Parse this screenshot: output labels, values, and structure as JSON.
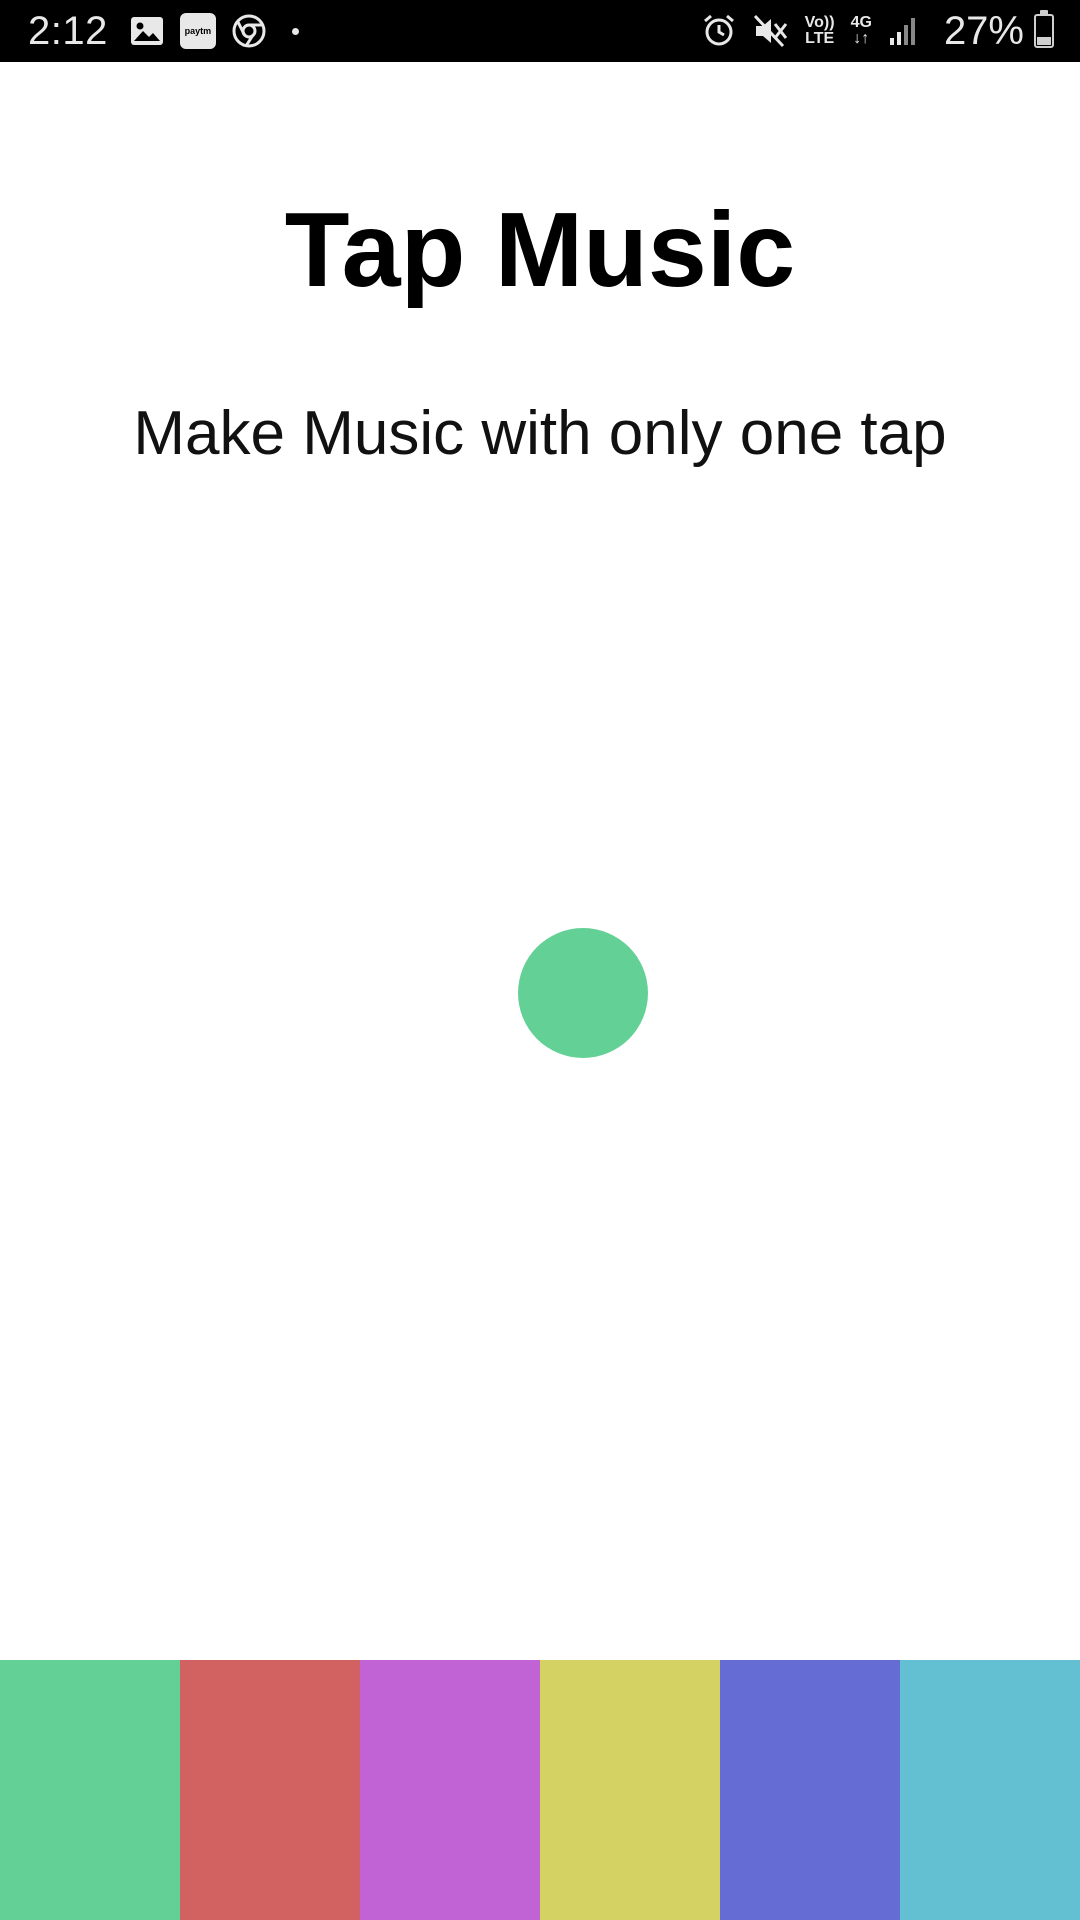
{
  "status_bar": {
    "time": "2:12",
    "icons": [
      "gallery-icon",
      "paytm-icon",
      "chrome-icon",
      "dot-icon",
      "alarm-icon",
      "mute-icon",
      "volte-icon",
      "network-4g-icon",
      "signal-icon",
      "battery-icon"
    ],
    "paytm_label": "paytm",
    "volte_top": "Vo))",
    "volte_bottom": "LTE",
    "network_label": "4G",
    "network_arrows": "↓↑",
    "battery_percent": "27%",
    "battery_level": 0.27
  },
  "main": {
    "title": "Tap Music",
    "subtitle": "Make Music with only one tap",
    "circle_color": "#63d195"
  },
  "pads": [
    {
      "color": "#63d195"
    },
    {
      "color": "#d26161"
    },
    {
      "color": "#c163d5"
    },
    {
      "color": "#d4d263"
    },
    {
      "color": "#656cd4"
    },
    {
      "color": "#63c0d2"
    }
  ]
}
